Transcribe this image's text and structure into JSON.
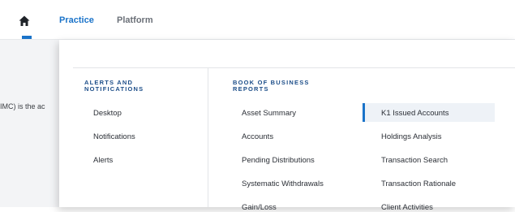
{
  "nav": {
    "tabs": [
      {
        "label": "Practice"
      },
      {
        "label": "Platform"
      }
    ]
  },
  "page": {
    "snippet": "IMC) is the ac"
  },
  "menu": {
    "columns": [
      {
        "heading_line1": "ALERTS AND",
        "heading_line2": "NOTIFICATIONS",
        "items": [
          "Desktop",
          "Notifications",
          "Alerts"
        ]
      },
      {
        "heading_line1": "BOOK OF BUSINESS",
        "heading_line2": "REPORTS",
        "items": [
          "Asset Summary",
          "Accounts",
          "Pending Distributions",
          "Systematic Withdrawals",
          "Gain/Loss"
        ]
      },
      {
        "items": [
          "K1 Issued Accounts",
          "Holdings Analysis",
          "Transaction Search",
          "Transaction Rationale",
          "Client Activities"
        ],
        "active_index": 0
      }
    ]
  },
  "colors": {
    "accent": "#1a73c9",
    "heading": "#1d4e89"
  }
}
